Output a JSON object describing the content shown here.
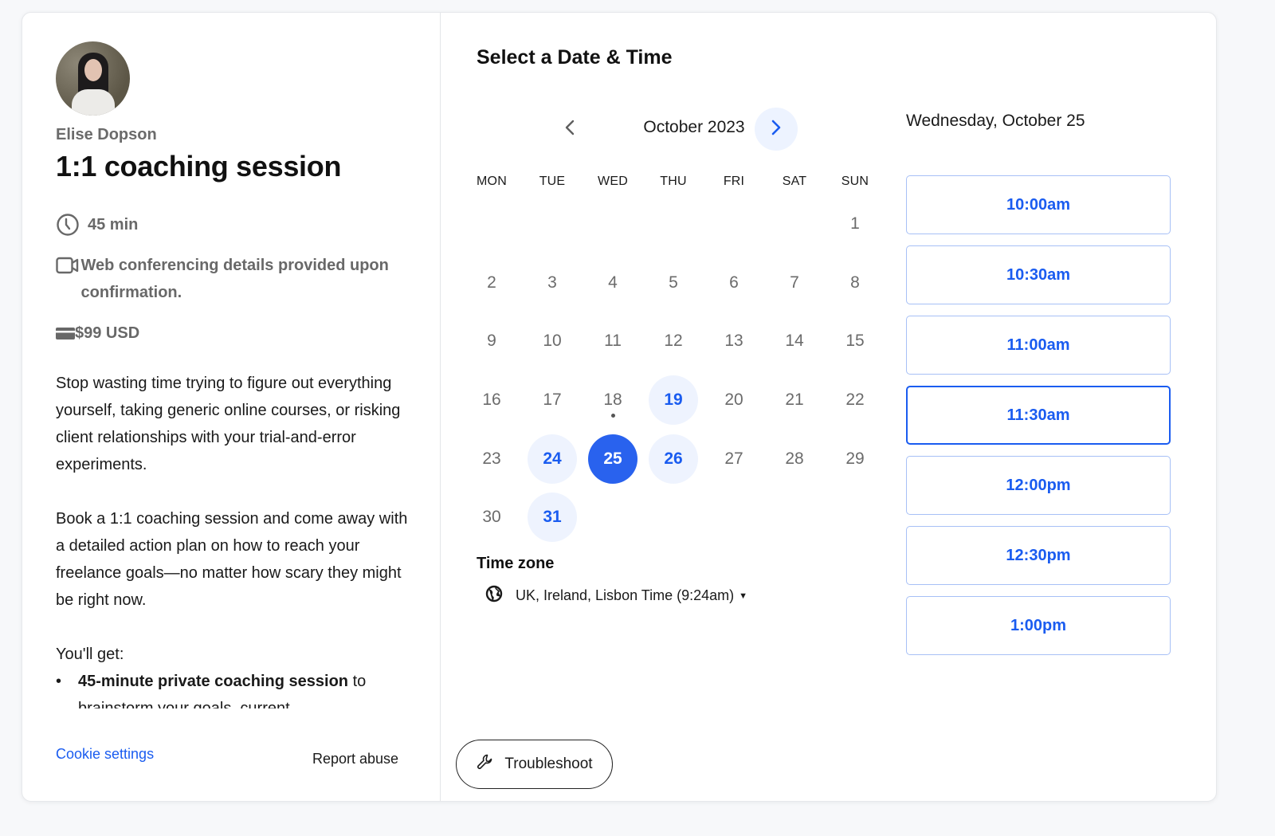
{
  "host": {
    "name": "Elise Dopson",
    "avatar_alt": "Elise Dopson profile photo"
  },
  "event": {
    "title": "1:1 coaching session",
    "duration": "45 min",
    "conferencing": "Web conferencing details provided upon confirmation.",
    "price": "$99 USD",
    "icons": {
      "duration": "clock-icon",
      "conferencing": "video-camera-icon",
      "price": "credit-card-icon"
    },
    "description": {
      "paragraph_1": "Stop wasting time trying to figure out everything yourself, taking generic online courses, or risking client relationships with your trial-and-error experiments.",
      "paragraph_2": "Book a 1:1 coaching session and come away with a detailed action plan on how to reach your freelance goals—no matter how scary they might be right now.",
      "list_intro": "You'll get:",
      "bullets": [
        {
          "bold": "45-minute private coaching session",
          "rest": " to brainstorm your goals, current"
        }
      ]
    }
  },
  "footer": {
    "cookie_settings": "Cookie settings",
    "report_abuse": "Report abuse"
  },
  "scheduler": {
    "title": "Select a Date & Time",
    "month_label": "October 2023",
    "prev_icon": "chevron-left-icon",
    "next_icon": "chevron-right-icon",
    "weekdays": [
      "MON",
      "TUE",
      "WED",
      "THU",
      "FRI",
      "SAT",
      "SUN"
    ],
    "leading_blanks": 6,
    "days_in_month": 31,
    "today": 18,
    "available_days": [
      19,
      24,
      26,
      31
    ],
    "selected_day": 25,
    "timezone": {
      "label": "Time zone",
      "value": "UK, Ireland, Lisbon Time (9:24am)",
      "icon": "globe-icon"
    },
    "troubleshoot": "Troubleshoot"
  },
  "times": {
    "date_heading": "Wednesday, October 25",
    "slots": [
      "10:00am",
      "10:30am",
      "11:00am",
      "11:30am",
      "12:00pm",
      "12:30pm",
      "1:00pm"
    ],
    "focused_slot": "11:30am"
  },
  "colors": {
    "accent": "#1a5cf0",
    "selected_day_bg": "#2962ee",
    "available_day_bg": "#eef3fe",
    "slot_border": "#a7c0f6"
  }
}
